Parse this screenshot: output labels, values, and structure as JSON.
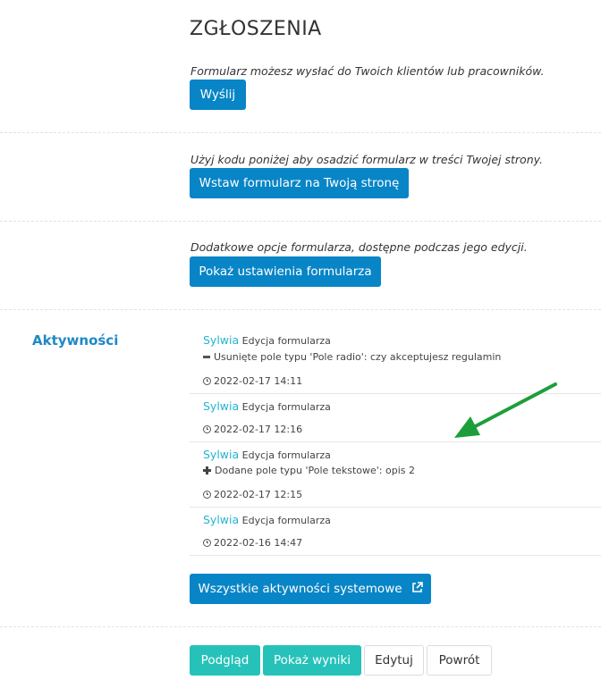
{
  "page": {
    "title": "ZGŁOSZENIA"
  },
  "send_section": {
    "description": "Formularz możesz wysłać do Twoich klientów lub pracowników.",
    "button": "Wyślij"
  },
  "embed_section": {
    "description": "Użyj kodu poniżej aby osadzić formularz w treści Twojej strony.",
    "button": "Wstaw formularz na Twoją stronę"
  },
  "settings_section": {
    "description": "Dodatkowe opcje formularza, dostępne podczas jego edycji.",
    "button": "Pokaż ustawienia formularza"
  },
  "activities": {
    "title": "Aktywności",
    "items": [
      {
        "user": "Sylwia",
        "action": "Edycja formularza",
        "detail": "Usunięte pole typu 'Pole radio': czy akceptujesz regulamin",
        "detail_icon": "minus-icon",
        "time": "2022-02-17 14:11"
      },
      {
        "user": "Sylwia",
        "action": "Edycja formularza",
        "detail": "",
        "time": "2022-02-17 12:16"
      },
      {
        "user": "Sylwia",
        "action": "Edycja formularza",
        "detail": "Dodane pole typu 'Pole tekstowe': opis 2",
        "detail_icon": "plus-icon",
        "time": "2022-02-17 12:15"
      },
      {
        "user": "Sylwia",
        "action": "Edycja formularza",
        "detail": "",
        "time": "2022-02-16 14:47"
      }
    ],
    "all_button": "Wszystkie aktywności systemowe"
  },
  "footer": {
    "preview": "Podgląd",
    "results": "Pokaż wyniki",
    "edit": "Edytuj",
    "back": "Powrót"
  },
  "colors": {
    "primary": "#0885c6",
    "teal": "#26c2ba",
    "link": "#23b4d2",
    "arrow": "#1e9e3a"
  }
}
